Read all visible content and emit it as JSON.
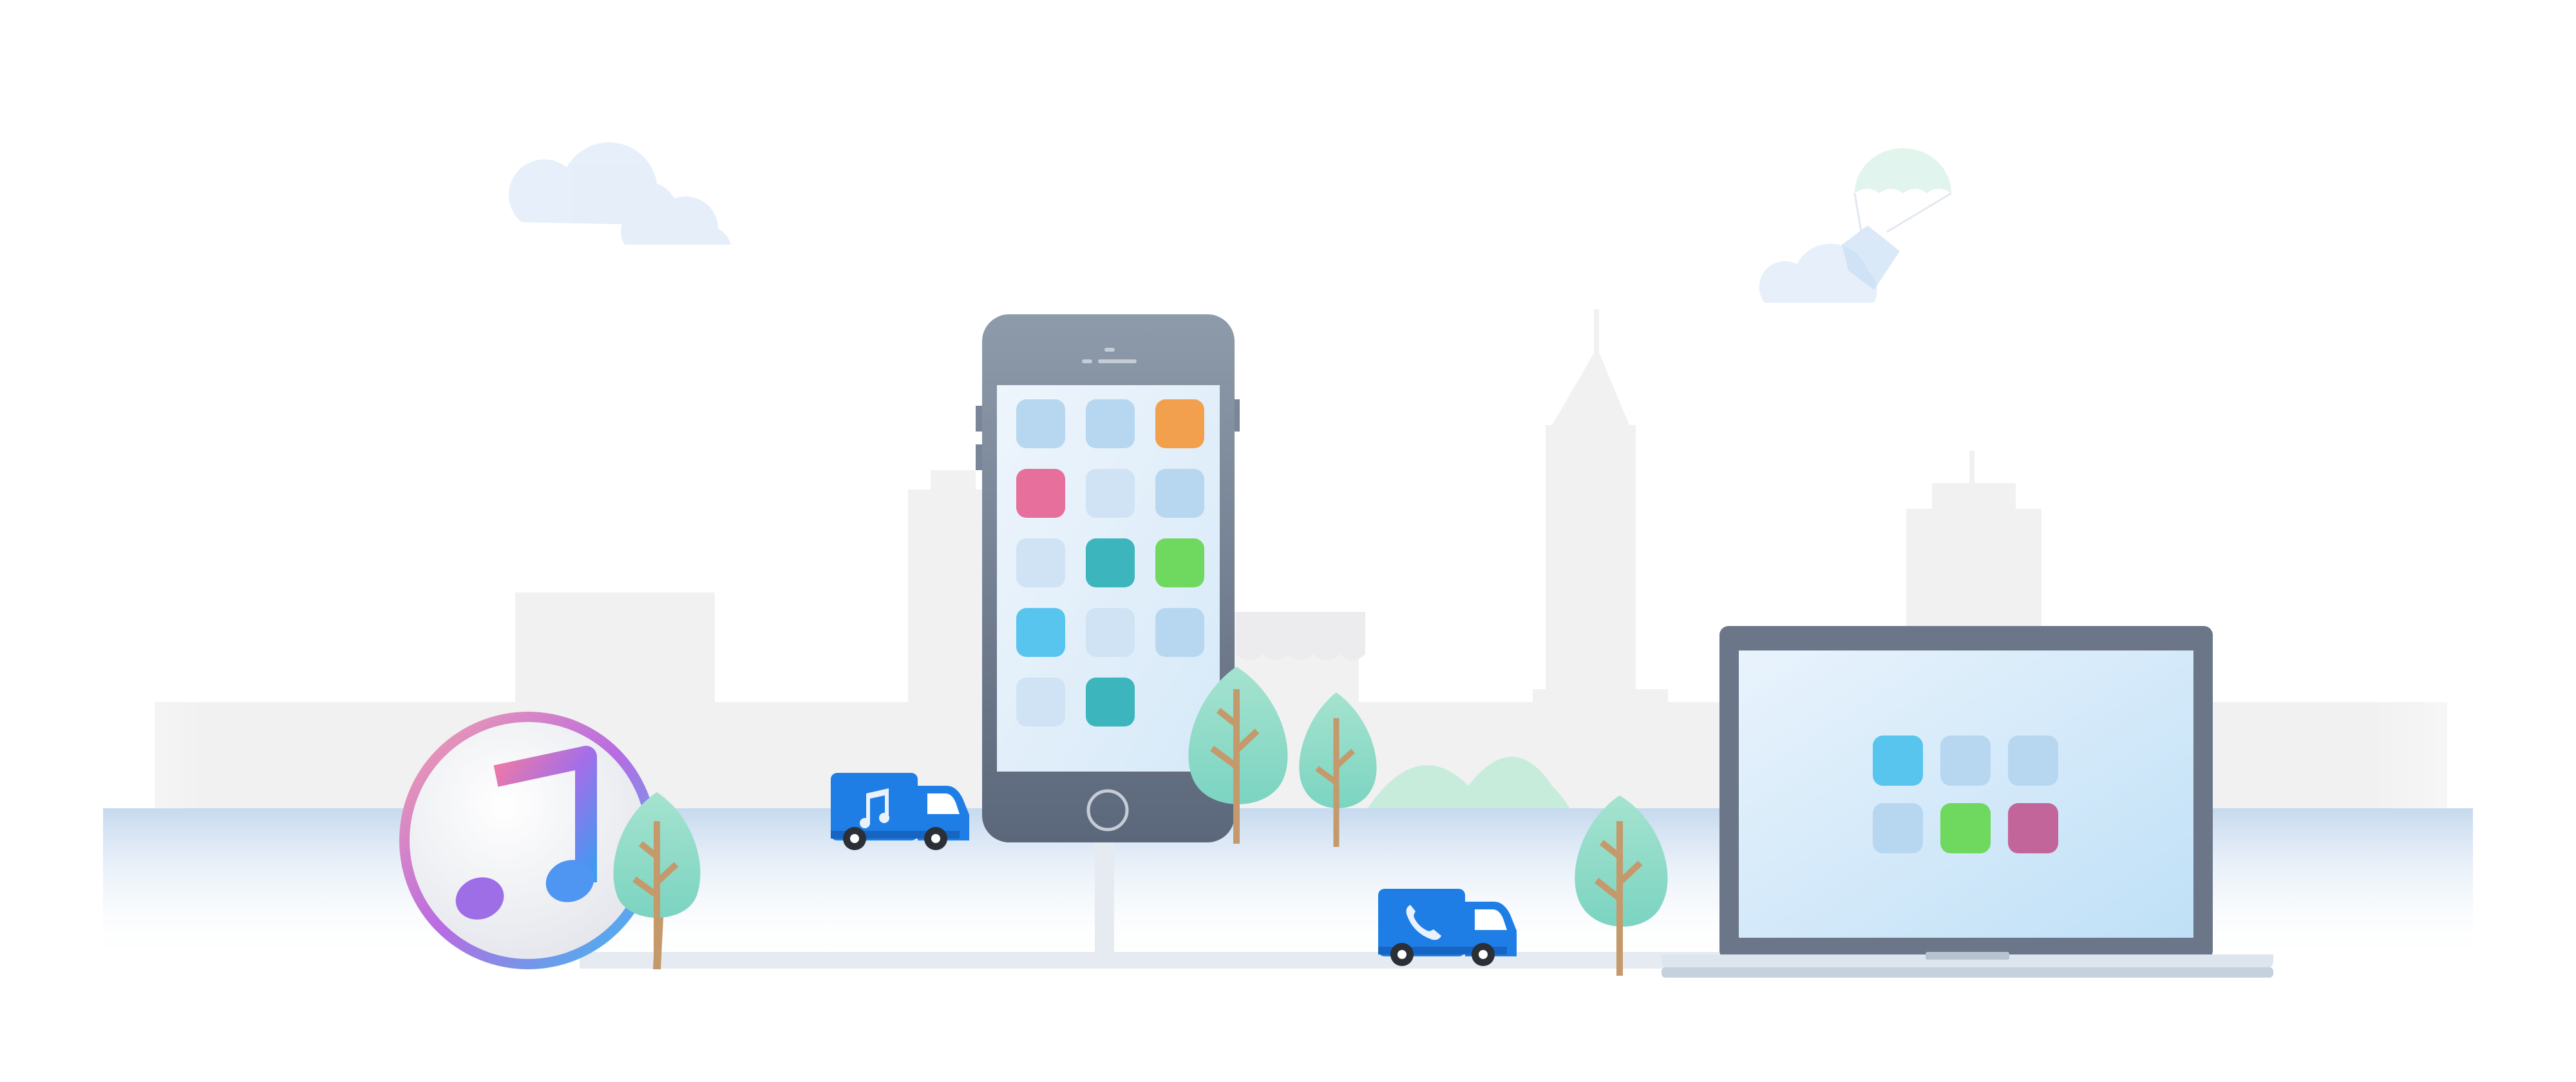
{
  "scene": {
    "description_free": true,
    "theme": {
      "sky": "#ffffff",
      "skyline": "#f1f1f2",
      "road": "#cfdff0",
      "road_edge": "#e6ebf1",
      "tree_leaf": "#8ddbc7",
      "tree_trunk": "#c49a6c",
      "truck_blue": "#1f7ee6",
      "device_frame": "#6b7789",
      "screen_light": "#d9eaf8"
    },
    "icons": {
      "itunes": "music-note-icon",
      "truck_music": "music-note-icon",
      "truck_phone": "phone-icon"
    },
    "phone_apps": [
      {
        "color": "#b7d7f0"
      },
      {
        "color": "#b7d7f0"
      },
      {
        "color": "#f3a04e"
      },
      {
        "color": "#e76f9b"
      },
      {
        "color": "#d0e3f5"
      },
      {
        "color": "#b7d7f0"
      },
      {
        "color": "#d0e3f5"
      },
      {
        "color": "#3cb5bd"
      },
      {
        "color": "#6fd85e"
      },
      {
        "color": "#58c5ef"
      },
      {
        "color": "#d0e3f5"
      },
      {
        "color": "#b7d7f0"
      },
      {
        "color": "#d0e3f5"
      },
      {
        "color": "#3cb5bd"
      }
    ],
    "laptop_apps": [
      {
        "color": "#58c5ef"
      },
      {
        "color": "#b7d7f0"
      },
      {
        "color": "#b7d7f0"
      },
      {
        "color": "#b7d7f0"
      },
      {
        "color": "#6fd85e"
      },
      {
        "color": "#c2659b"
      }
    ]
  }
}
